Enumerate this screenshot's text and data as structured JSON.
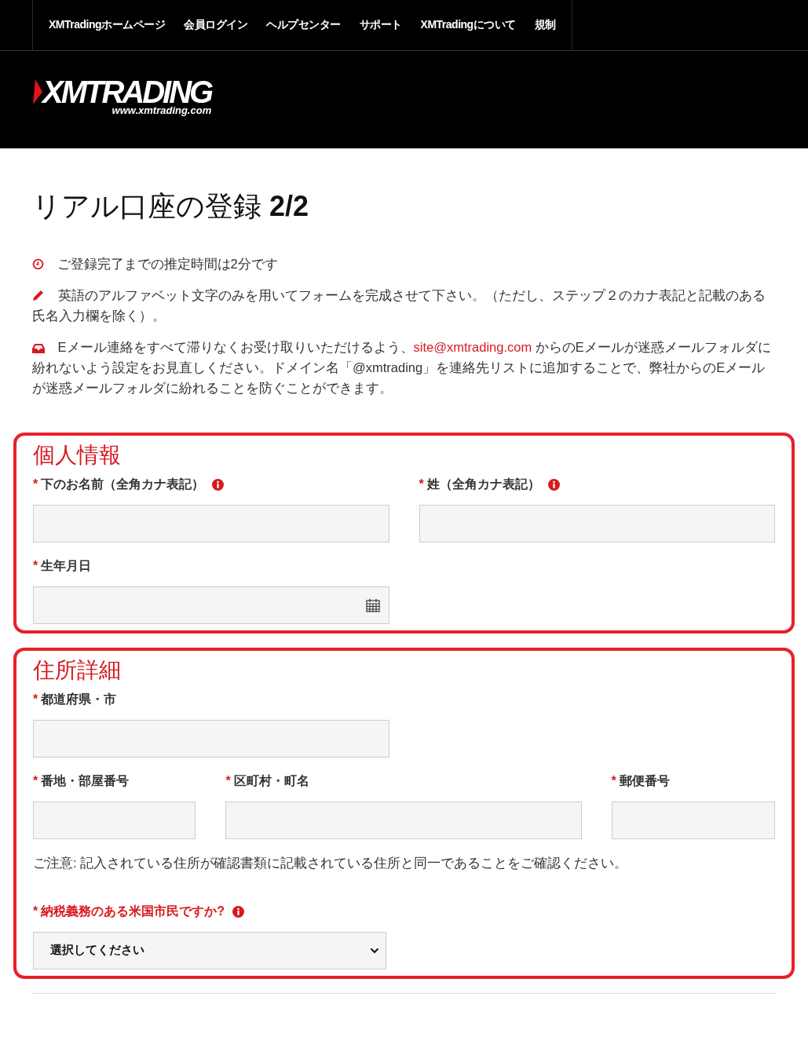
{
  "top_nav": [
    {
      "label": "XMTradingホームページ"
    },
    {
      "label": "会員ログイン"
    },
    {
      "label": "ヘルプセンター"
    },
    {
      "label": "サポート"
    },
    {
      "label": "XMTradingについて"
    },
    {
      "label": "規制"
    }
  ],
  "logo": {
    "name": "XMTRADING",
    "url": "www.xmtrading.com"
  },
  "page_title": {
    "text": "リアル口座の登録",
    "step": "2/2"
  },
  "notices": [
    {
      "text": "ご登録完了までの推定時間は2分です"
    },
    {
      "text": "英語のアルファベット文字のみを用いてフォームを完成させて下さい。（ただし、ステップ２のカナ表記と記載のある氏名入力欄を除く）。"
    },
    {
      "text": "Eメール連絡をすべて滞りなくお受け取りいただけるよう、",
      "link": "site@xmtrading.com",
      "text_after": " からのEメールが迷惑メールフォルダに紛れないよう設定をお見直しください。ドメイン名「@xmtrading」を連絡先リストに追加することで、弊社からのEメールが迷惑メールフォルダに紛れることを防ぐことができます。"
    }
  ],
  "sections": [
    {
      "title": "個人情報",
      "rows": [
        [
          {
            "kind": "text",
            "mark": "*",
            "label": "下のお名前（全角カナ表記）",
            "info": true
          },
          {
            "kind": "text",
            "mark": "*",
            "label": "姓（全角カナ表記）",
            "info": true
          }
        ],
        [
          {
            "kind": "date",
            "mark": "*",
            "label": "生年月日",
            "info": false
          }
        ]
      ]
    },
    {
      "title": "住所詳細",
      "rows": [
        [
          {
            "kind": "text",
            "mark": "*",
            "label": "都道府県・市",
            "info": false
          }
        ],
        [
          {
            "kind": "text",
            "mark": "*",
            "label": "番地・部屋番号",
            "info": false
          },
          {
            "kind": "text",
            "mark": "*",
            "label": "区町村・町名",
            "info": false
          },
          {
            "kind": "text",
            "mark": "*",
            "label": "郵便番号",
            "info": false
          }
        ]
      ],
      "note": "ご注意: 記入されている住所が確認書類に記載されている住所と同一であることをご確認ください。",
      "question": {
        "kind": "select",
        "mark": "*",
        "label": "納税義務のある米国市民ですか?",
        "info": true,
        "value": "選択してください"
      }
    }
  ]
}
